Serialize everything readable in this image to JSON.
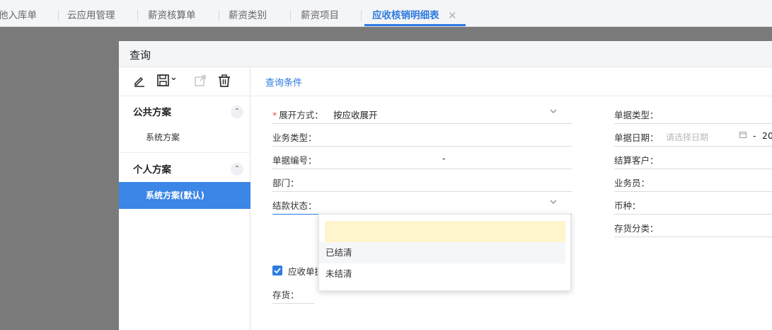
{
  "tabs": [
    {
      "label": "他入库单"
    },
    {
      "label": "云应用管理"
    },
    {
      "label": "薪资核算单"
    },
    {
      "label": "薪资类别"
    },
    {
      "label": "薪资项目"
    },
    {
      "label": "应收核销明细表",
      "active": true
    }
  ],
  "tab_close_glyph": "✕",
  "dialog": {
    "title": "查询"
  },
  "toolbar": {
    "icons": [
      "edit-icon",
      "save-icon",
      "export-icon",
      "delete-icon"
    ],
    "save_dropdown_glyph": "⌄"
  },
  "schemes": {
    "public_title": "公共方案",
    "public_items": [
      "系统方案"
    ],
    "personal_title": "个人方案",
    "personal_items": [
      "系统方案(默认)"
    ],
    "collapse_glyph": "⌃"
  },
  "form": {
    "section_title": "查询条件",
    "expand_mode": {
      "required_mark": "*",
      "label": "展开方式：",
      "value": "按应收展开"
    },
    "business_type": {
      "label": "业务类型："
    },
    "doc_number": {
      "label": "单据编号：",
      "range_sep": "-"
    },
    "department": {
      "label": "部门："
    },
    "settle_status": {
      "label": "结款状态："
    },
    "ar_doc_checkbox": {
      "label": "应收单据",
      "checked": true
    },
    "inventory": {
      "label": "存货："
    },
    "doc_type": {
      "label": "单据类型："
    },
    "doc_date": {
      "label": "单据日期：",
      "placeholder": "请选择日期",
      "range_sep": "-",
      "end_partial": "20"
    },
    "settle_customer": {
      "label": "结算客户："
    },
    "salesperson": {
      "label": "业务员："
    },
    "currency": {
      "label": "币种："
    },
    "inventory_category": {
      "label": "存货分类："
    }
  },
  "dropdown": {
    "options": [
      "",
      "已结清",
      "未结清"
    ]
  },
  "colors": {
    "accent": "#2d7ae0",
    "selected_bg": "#3b86e6",
    "highlight": "#fff5cc",
    "required": "#e34d4d"
  }
}
